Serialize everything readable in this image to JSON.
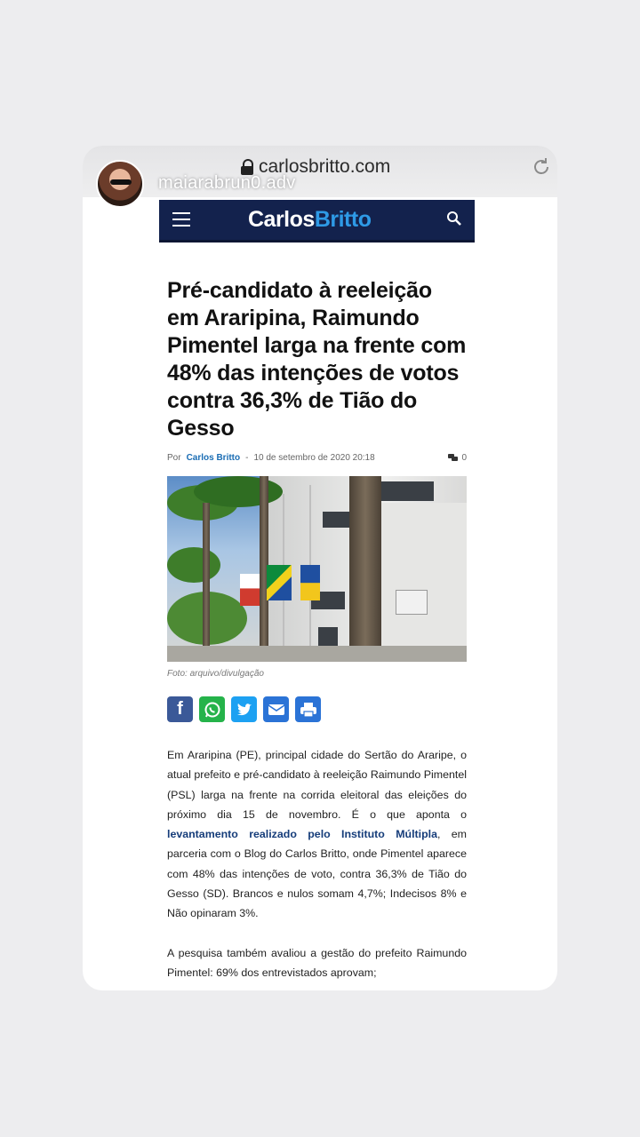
{
  "browser": {
    "url": "carlosbritto.com",
    "username": "maiarabrun0.adv"
  },
  "site": {
    "logo_part1": "Carlos",
    "logo_part2": "Britto",
    "brand_color": "#13224d",
    "accent_color": "#2e9ae6"
  },
  "article": {
    "title": "Pré-candidato à reeleição em Araripina, Raimundo Pimentel larga na frente com 48% das intenções de votos contra 36,3% de Tião do Gesso",
    "by": "Por",
    "author": "Carlos Britto",
    "separator": "-",
    "date": "10 de setembro de 2020 20:18",
    "comment_count": "0",
    "caption": "Foto: arquivo/divulgação",
    "share_buttons": [
      "facebook-icon",
      "whatsapp-icon",
      "twitter-icon",
      "email-icon",
      "print-icon"
    ],
    "p1_before": "Em Araripina (PE), principal cidade do Sertão do Araripe, o atual prefeito e pré-candidato à reeleição Raimundo Pimentel (PSL) larga na frente na corrida eleitoral das eleições do próximo dia 15 de novembro. É o que aponta o ",
    "p1_link": "levantamento realizado pelo Instituto Múltipla",
    "p1_after": ", em parceria com o Blog do Carlos Britto, onde Pimentel aparece com 48% das intenções de voto, contra 36,3% de Tião do Gesso (SD). Brancos e nulos somam 4,7%; Indecisos 8% e Não opinaram 3%.",
    "p2": "A pesquisa também avaliou a gestão do prefeito Raimundo Pimentel: 69% dos entrevistados aprovam;"
  }
}
